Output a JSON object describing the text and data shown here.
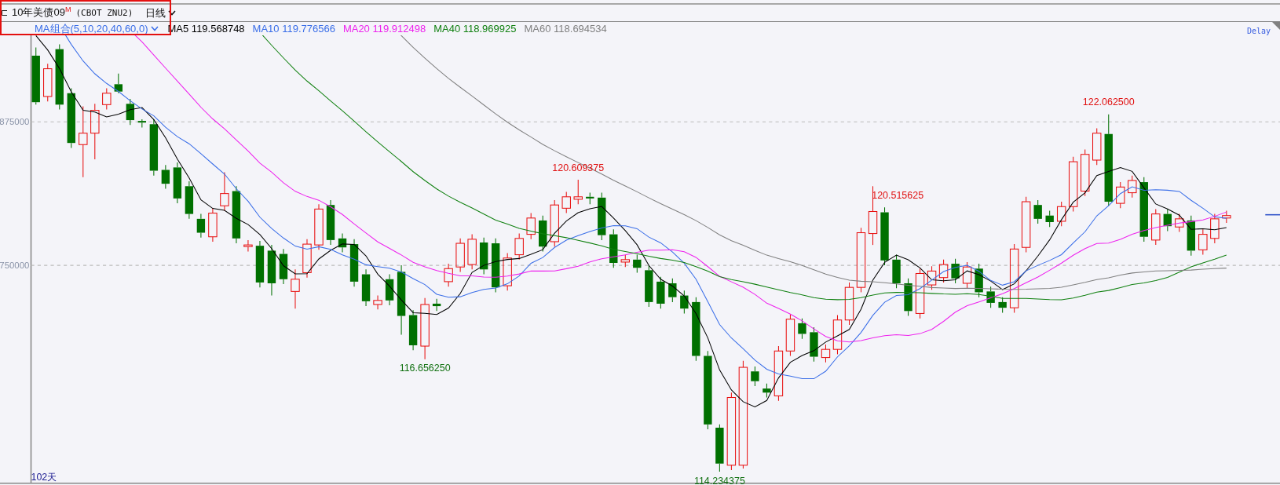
{
  "header": {
    "title": "10年美债09$^{M}$",
    "code": "(CBOT ZNU2)",
    "period": "日线"
  },
  "legend": {
    "group": "MA组合(5,10,20,40,60,0)",
    "lines": [
      {
        "label": "MA5 119.568748",
        "color": "#000000"
      },
      {
        "label": "MA10 119.776566",
        "color": "#3a6ee8"
      },
      {
        "label": "MA20 119.912498",
        "color": "#ee22ee"
      },
      {
        "label": "MA40 118.969925",
        "color": "#108010"
      },
      {
        "label": "MA60 118.694534",
        "color": "#808080"
      }
    ]
  },
  "status": "Delay",
  "y_axis": [
    "875000",
    "750000"
  ],
  "price_labels": [
    {
      "text": "120.609375",
      "kind": "high"
    },
    {
      "text": "116.656250",
      "kind": "low"
    },
    {
      "text": "120.515625",
      "kind": "high"
    },
    {
      "text": "114.234375",
      "kind": "low"
    },
    {
      "text": "122.062500",
      "kind": "high"
    }
  ],
  "footer": "102天"
}
